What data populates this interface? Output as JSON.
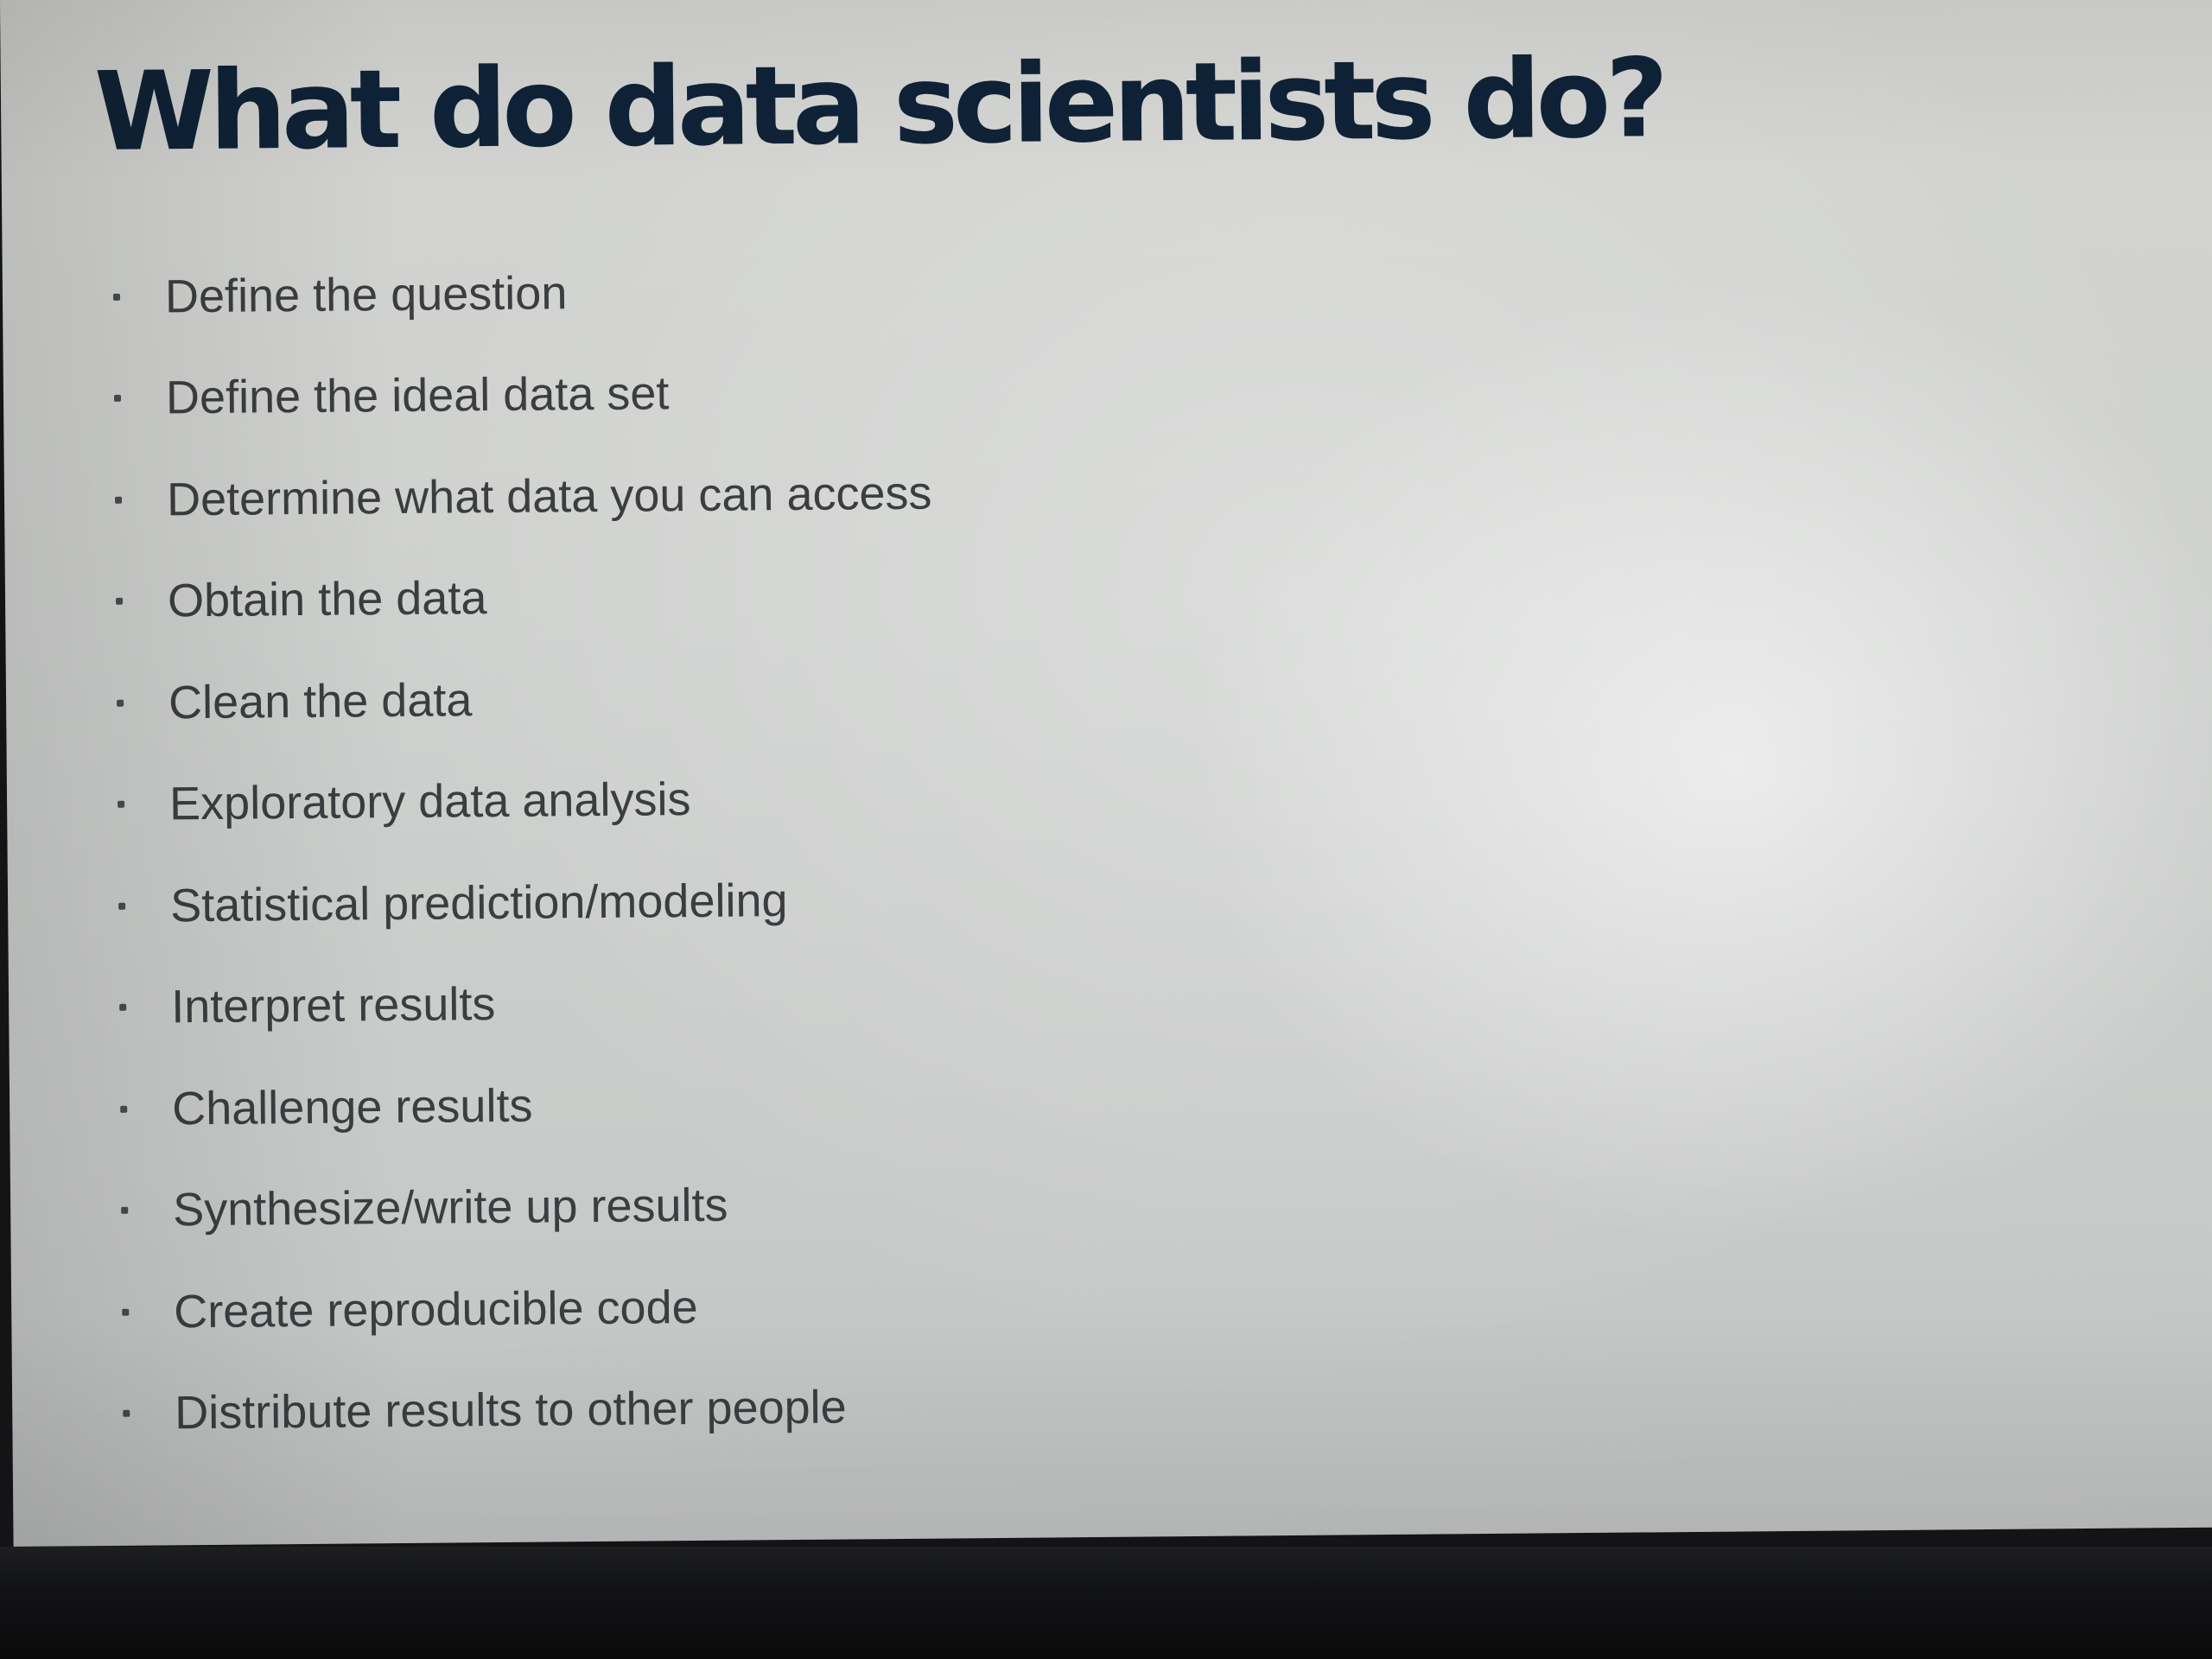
{
  "slide": {
    "title": "What do data scientists do?",
    "bullets": [
      "Define the question",
      "Define the ideal data set",
      "Determine what data you can access",
      "Obtain the data",
      "Clean the data",
      "Exploratory data analysis",
      "Statistical prediction/modeling",
      "Interpret results",
      "Challenge results",
      "Synthesize/write up results",
      "Create reproducible code",
      "Distribute results to other people"
    ]
  }
}
